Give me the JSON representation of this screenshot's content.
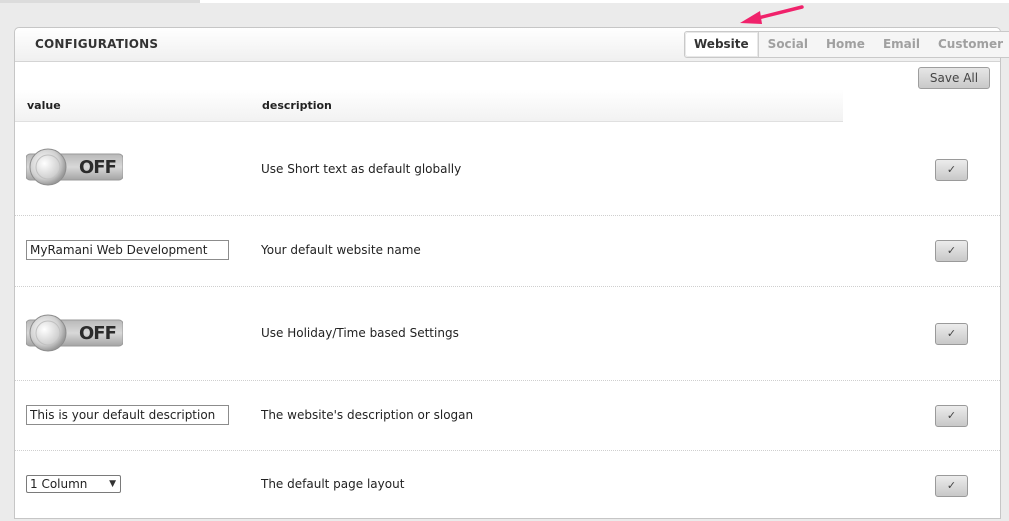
{
  "panel": {
    "title": "CONFIGURATIONS"
  },
  "tabs": [
    {
      "label": "Website",
      "active": true
    },
    {
      "label": "Social"
    },
    {
      "label": "Home"
    },
    {
      "label": "Email"
    },
    {
      "label": "Customer"
    }
  ],
  "toolbar": {
    "save_all_label": "Save All"
  },
  "table": {
    "headers": {
      "value": "value",
      "description": "description"
    },
    "rows": [
      {
        "type": "toggle",
        "value": "OFF",
        "description": "Use Short text as default globally"
      },
      {
        "type": "text",
        "value": "MyRamani Web Development",
        "description": "Your default website name"
      },
      {
        "type": "toggle",
        "value": "OFF",
        "description": "Use Holiday/Time based Settings"
      },
      {
        "type": "text",
        "value": "This is your default description",
        "description": "The website's description or slogan"
      },
      {
        "type": "select",
        "value": "1 Column",
        "description": "The default page layout"
      }
    ]
  },
  "icons": {
    "save_row": "check-icon",
    "dropdown": "chevron-down-icon",
    "annotation": "arrow-icon"
  },
  "colors": {
    "annotation_arrow": "#f0226b"
  }
}
